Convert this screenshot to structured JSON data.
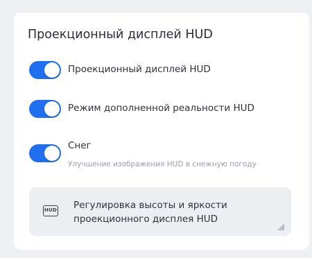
{
  "section": {
    "title": "Проекционный дисплей HUD"
  },
  "toggles": [
    {
      "label": "Проекционный дисплей HUD",
      "state": "on"
    },
    {
      "label": "Режим дополненной реальности HUD",
      "state": "on"
    },
    {
      "label": "Снег",
      "description": "Улучшение изображения HUD в снежную погоду",
      "state": "on"
    }
  ],
  "adjust_panel": {
    "icon_text": "HUD",
    "line1": "Регулировка высоты и яркости",
    "line2": "проекционного дисплея HUD"
  },
  "colors": {
    "accent": "#1f6ff0",
    "panel": "#eceef2",
    "background": "#eef0f4"
  }
}
